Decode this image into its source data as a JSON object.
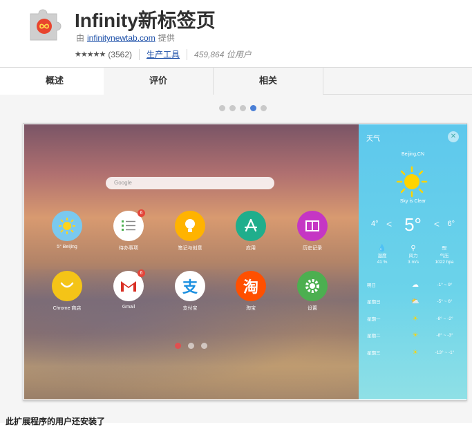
{
  "header": {
    "title": "Infinity新标签页",
    "by_prefix": "由",
    "publisher": "infinitynewtab.com",
    "by_suffix": "提供",
    "stars": "★★★★★",
    "rating_count": "(3562)",
    "category": "生产工具",
    "users": "459,864 位用户"
  },
  "tabs": [
    {
      "label": "概述",
      "active": true
    },
    {
      "label": "评价",
      "active": false
    },
    {
      "label": "相关",
      "active": false
    }
  ],
  "carousel": {
    "count": 5,
    "active_index": 3
  },
  "screenshot": {
    "search_placeholder": "Google",
    "apps": [
      {
        "label": "5° Beijing",
        "icon": "weather-sun-icon"
      },
      {
        "label": "待办事项",
        "icon": "todo-list-icon",
        "badge": "6"
      },
      {
        "label": "笔记与创意",
        "icon": "lightbulb-icon"
      },
      {
        "label": "应用",
        "icon": "app-store-icon"
      },
      {
        "label": "历史记录",
        "icon": "history-book-icon"
      },
      {
        "label": "Chrome 商店",
        "icon": "chrome-store-icon"
      },
      {
        "label": "Gmail",
        "icon": "gmail-icon",
        "badge": "6"
      },
      {
        "label": "支付宝",
        "icon": "alipay-icon"
      },
      {
        "label": "淘宝",
        "icon": "taobao-icon"
      },
      {
        "label": "设置",
        "icon": "settings-gear-icon"
      }
    ],
    "page_dots": {
      "count": 3,
      "active_index": 0
    },
    "weather": {
      "title": "天气",
      "city": "Beijing,CN",
      "description": "Sky is Clear",
      "temp": "5°",
      "low": "4°",
      "high": "6°",
      "stats": [
        {
          "label": "湿度",
          "value": "41 %",
          "icon": "humidity-drop-icon"
        },
        {
          "label": "风力",
          "value": "3 m/s",
          "icon": "wind-turbine-icon"
        },
        {
          "label": "气压",
          "value": "1022 hpa",
          "icon": "pressure-icon"
        }
      ],
      "forecast": [
        {
          "day": "明日",
          "icon": "cloud-icon",
          "range": "-1° ~ 9°"
        },
        {
          "day": "星期日",
          "icon": "cloud-sun-icon",
          "range": "-5° ~ 6°"
        },
        {
          "day": "星期一",
          "icon": "sun-icon",
          "range": "-8° ~ -2°"
        },
        {
          "day": "星期二",
          "icon": "sun-icon",
          "range": "-8° ~ -3°"
        },
        {
          "day": "星期三",
          "icon": "sun-icon",
          "range": "-13° ~ -1°"
        }
      ]
    }
  },
  "footer_text": "此扩展程序的用户还安装了"
}
